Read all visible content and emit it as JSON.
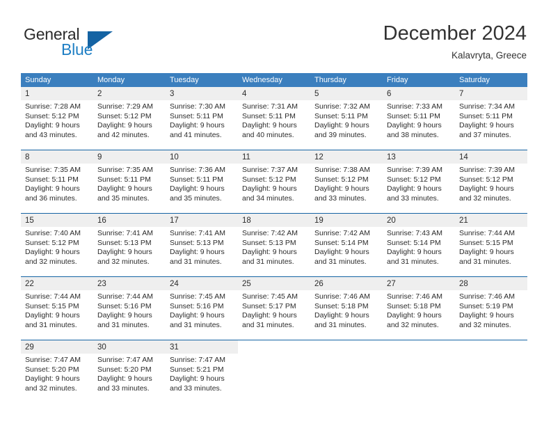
{
  "brand": {
    "name_part1": "General",
    "name_part2": "Blue",
    "accent_color": "#1f7fc4",
    "triangle_color": "#1463a3"
  },
  "header": {
    "month_title": "December 2024",
    "location": "Kalavryta, Greece"
  },
  "calendar": {
    "header_background": "#3b7fbe",
    "row_separator_color": "#1463a3",
    "day_band_color": "#efefef",
    "weekdays": [
      "Sunday",
      "Monday",
      "Tuesday",
      "Wednesday",
      "Thursday",
      "Friday",
      "Saturday"
    ],
    "weeks": [
      [
        {
          "day": "1",
          "lines": [
            "Sunrise: 7:28 AM",
            "Sunset: 5:12 PM",
            "Daylight: 9 hours",
            "and 43 minutes."
          ]
        },
        {
          "day": "2",
          "lines": [
            "Sunrise: 7:29 AM",
            "Sunset: 5:12 PM",
            "Daylight: 9 hours",
            "and 42 minutes."
          ]
        },
        {
          "day": "3",
          "lines": [
            "Sunrise: 7:30 AM",
            "Sunset: 5:11 PM",
            "Daylight: 9 hours",
            "and 41 minutes."
          ]
        },
        {
          "day": "4",
          "lines": [
            "Sunrise: 7:31 AM",
            "Sunset: 5:11 PM",
            "Daylight: 9 hours",
            "and 40 minutes."
          ]
        },
        {
          "day": "5",
          "lines": [
            "Sunrise: 7:32 AM",
            "Sunset: 5:11 PM",
            "Daylight: 9 hours",
            "and 39 minutes."
          ]
        },
        {
          "day": "6",
          "lines": [
            "Sunrise: 7:33 AM",
            "Sunset: 5:11 PM",
            "Daylight: 9 hours",
            "and 38 minutes."
          ]
        },
        {
          "day": "7",
          "lines": [
            "Sunrise: 7:34 AM",
            "Sunset: 5:11 PM",
            "Daylight: 9 hours",
            "and 37 minutes."
          ]
        }
      ],
      [
        {
          "day": "8",
          "lines": [
            "Sunrise: 7:35 AM",
            "Sunset: 5:11 PM",
            "Daylight: 9 hours",
            "and 36 minutes."
          ]
        },
        {
          "day": "9",
          "lines": [
            "Sunrise: 7:35 AM",
            "Sunset: 5:11 PM",
            "Daylight: 9 hours",
            "and 35 minutes."
          ]
        },
        {
          "day": "10",
          "lines": [
            "Sunrise: 7:36 AM",
            "Sunset: 5:11 PM",
            "Daylight: 9 hours",
            "and 35 minutes."
          ]
        },
        {
          "day": "11",
          "lines": [
            "Sunrise: 7:37 AM",
            "Sunset: 5:12 PM",
            "Daylight: 9 hours",
            "and 34 minutes."
          ]
        },
        {
          "day": "12",
          "lines": [
            "Sunrise: 7:38 AM",
            "Sunset: 5:12 PM",
            "Daylight: 9 hours",
            "and 33 minutes."
          ]
        },
        {
          "day": "13",
          "lines": [
            "Sunrise: 7:39 AM",
            "Sunset: 5:12 PM",
            "Daylight: 9 hours",
            "and 33 minutes."
          ]
        },
        {
          "day": "14",
          "lines": [
            "Sunrise: 7:39 AM",
            "Sunset: 5:12 PM",
            "Daylight: 9 hours",
            "and 32 minutes."
          ]
        }
      ],
      [
        {
          "day": "15",
          "lines": [
            "Sunrise: 7:40 AM",
            "Sunset: 5:12 PM",
            "Daylight: 9 hours",
            "and 32 minutes."
          ]
        },
        {
          "day": "16",
          "lines": [
            "Sunrise: 7:41 AM",
            "Sunset: 5:13 PM",
            "Daylight: 9 hours",
            "and 32 minutes."
          ]
        },
        {
          "day": "17",
          "lines": [
            "Sunrise: 7:41 AM",
            "Sunset: 5:13 PM",
            "Daylight: 9 hours",
            "and 31 minutes."
          ]
        },
        {
          "day": "18",
          "lines": [
            "Sunrise: 7:42 AM",
            "Sunset: 5:13 PM",
            "Daylight: 9 hours",
            "and 31 minutes."
          ]
        },
        {
          "day": "19",
          "lines": [
            "Sunrise: 7:42 AM",
            "Sunset: 5:14 PM",
            "Daylight: 9 hours",
            "and 31 minutes."
          ]
        },
        {
          "day": "20",
          "lines": [
            "Sunrise: 7:43 AM",
            "Sunset: 5:14 PM",
            "Daylight: 9 hours",
            "and 31 minutes."
          ]
        },
        {
          "day": "21",
          "lines": [
            "Sunrise: 7:44 AM",
            "Sunset: 5:15 PM",
            "Daylight: 9 hours",
            "and 31 minutes."
          ]
        }
      ],
      [
        {
          "day": "22",
          "lines": [
            "Sunrise: 7:44 AM",
            "Sunset: 5:15 PM",
            "Daylight: 9 hours",
            "and 31 minutes."
          ]
        },
        {
          "day": "23",
          "lines": [
            "Sunrise: 7:44 AM",
            "Sunset: 5:16 PM",
            "Daylight: 9 hours",
            "and 31 minutes."
          ]
        },
        {
          "day": "24",
          "lines": [
            "Sunrise: 7:45 AM",
            "Sunset: 5:16 PM",
            "Daylight: 9 hours",
            "and 31 minutes."
          ]
        },
        {
          "day": "25",
          "lines": [
            "Sunrise: 7:45 AM",
            "Sunset: 5:17 PM",
            "Daylight: 9 hours",
            "and 31 minutes."
          ]
        },
        {
          "day": "26",
          "lines": [
            "Sunrise: 7:46 AM",
            "Sunset: 5:18 PM",
            "Daylight: 9 hours",
            "and 31 minutes."
          ]
        },
        {
          "day": "27",
          "lines": [
            "Sunrise: 7:46 AM",
            "Sunset: 5:18 PM",
            "Daylight: 9 hours",
            "and 32 minutes."
          ]
        },
        {
          "day": "28",
          "lines": [
            "Sunrise: 7:46 AM",
            "Sunset: 5:19 PM",
            "Daylight: 9 hours",
            "and 32 minutes."
          ]
        }
      ],
      [
        {
          "day": "29",
          "lines": [
            "Sunrise: 7:47 AM",
            "Sunset: 5:20 PM",
            "Daylight: 9 hours",
            "and 32 minutes."
          ]
        },
        {
          "day": "30",
          "lines": [
            "Sunrise: 7:47 AM",
            "Sunset: 5:20 PM",
            "Daylight: 9 hours",
            "and 33 minutes."
          ]
        },
        {
          "day": "31",
          "lines": [
            "Sunrise: 7:47 AM",
            "Sunset: 5:21 PM",
            "Daylight: 9 hours",
            "and 33 minutes."
          ]
        },
        {
          "day": "",
          "lines": []
        },
        {
          "day": "",
          "lines": []
        },
        {
          "day": "",
          "lines": []
        },
        {
          "day": "",
          "lines": []
        }
      ]
    ]
  }
}
